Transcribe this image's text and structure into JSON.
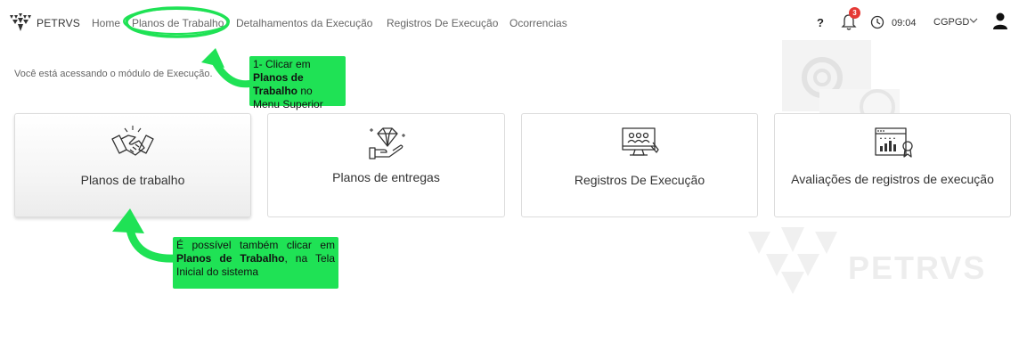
{
  "header": {
    "brand": "PETRVS",
    "nav": {
      "home": "Home",
      "planos": "Planos de Trabalho",
      "detalhamentos": "Detalhamentos da Execução",
      "registros": "Registros De Execução",
      "ocorrencias": "Ocorrencias"
    },
    "help_label": "?",
    "notification_count": "3",
    "time": "09:04",
    "unit": "CGPGD"
  },
  "main": {
    "intro_text": "Você está acessando o módulo de Execução.",
    "cards": [
      {
        "label": "Planos de trabalho",
        "icon": "handshake-icon"
      },
      {
        "label": "Planos de entregas",
        "icon": "diamond-hand-icon"
      },
      {
        "label": "Registros De Execução",
        "icon": "monitor-team-icon"
      },
      {
        "label": "Avaliações de registros de execução",
        "icon": "rating-certificate-icon"
      }
    ]
  },
  "watermark": {
    "text": "PETRVS"
  },
  "annotations": {
    "callout1": {
      "pre": "1- Clicar em ",
      "bold": "Planos de Trabalho",
      "post": " no Menu Superior"
    },
    "callout2": {
      "pre": "É possível também clicar em ",
      "bold": "Planos de Trabalho",
      "post": ", na Tela Inicial do sistema"
    }
  },
  "colors": {
    "accent_green": "#1fe255",
    "badge_red": "#e53935"
  }
}
